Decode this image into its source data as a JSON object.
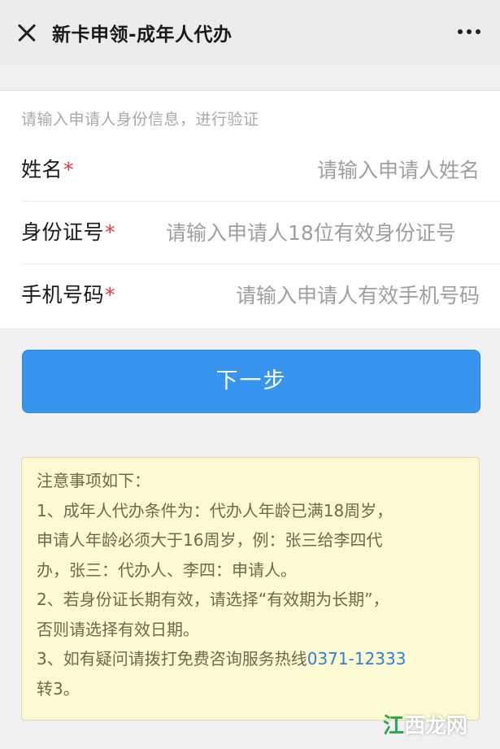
{
  "header": {
    "title": "新卡申领-成年人代办",
    "close_icon": "close-icon",
    "more_icon": "more-dots-icon"
  },
  "form": {
    "hint": "请输入申请人身份信息，进行验证",
    "fields": [
      {
        "label": "姓名",
        "required_mark": "*",
        "placeholder": "请输入申请人姓名",
        "value": ""
      },
      {
        "label": "身份证号",
        "required_mark": "*",
        "placeholder": "请输入申请人18位有效身份证号",
        "value": ""
      },
      {
        "label": "手机号码",
        "required_mark": "*",
        "placeholder": "请输入申请人有效手机号码",
        "value": ""
      }
    ]
  },
  "next_button": {
    "label": "下一步"
  },
  "notice": {
    "lines": [
      "注意事项如下：",
      "1、成年人代办条件为：代办人年龄已满18周岁，",
      "申请人年龄必须大于16周岁，例：张三给李四代",
      "办，张三：代办人、李四：申请人。",
      "2、若身份证长期有效，请选择“有效期为长期”，",
      "否则请选择有效日期。"
    ],
    "line3_prefix": "3、如有疑问请拨打免费咨询服务热线",
    "hotline": "0371-12333",
    "line3_suffix": "转3。"
  },
  "watermark": {
    "text_a": "江",
    "text_b": "西龙网"
  },
  "colors": {
    "primary_button": "#3794ef",
    "required_mark": "#e4393c",
    "notice_background": "#fdfbd3",
    "hotline_link": "#2d7fd8"
  }
}
